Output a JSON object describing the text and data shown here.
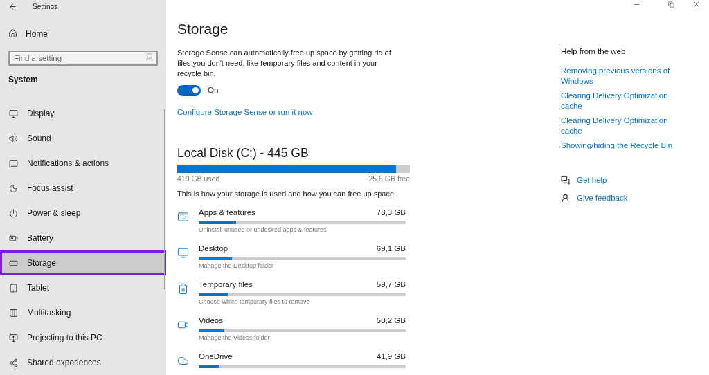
{
  "window": {
    "title": "Settings"
  },
  "sidebar": {
    "home": "Home",
    "search": {
      "placeholder": "Find a setting"
    },
    "section": "System",
    "items": [
      {
        "label": "Display",
        "selected": false
      },
      {
        "label": "Sound",
        "selected": false
      },
      {
        "label": "Notifications & actions",
        "selected": false
      },
      {
        "label": "Focus assist",
        "selected": false
      },
      {
        "label": "Power & sleep",
        "selected": false
      },
      {
        "label": "Battery",
        "selected": false
      },
      {
        "label": "Storage",
        "selected": true
      },
      {
        "label": "Tablet",
        "selected": false
      },
      {
        "label": "Multitasking",
        "selected": false
      },
      {
        "label": "Projecting to this PC",
        "selected": false
      },
      {
        "label": "Shared experiences",
        "selected": false
      }
    ]
  },
  "page": {
    "title": "Storage",
    "description": "Storage Sense can automatically free up space by getting rid of files you don't need, like temporary files and content in your recycle bin.",
    "toggle": {
      "on": true,
      "label": "On"
    },
    "configure_link": "Configure Storage Sense or run it now",
    "disk": {
      "title": "Local Disk (C:) - 445 GB",
      "level": 0.94,
      "used": "419 GB used",
      "free": "25,6 GB free"
    },
    "usage_intro": "This is how your storage is used and how you can free up space.",
    "categories": [
      {
        "name": "Apps & features",
        "size": "78,3 GB",
        "level": 0.18,
        "hint": "Uninstall unused or undesired apps & features"
      },
      {
        "name": "Desktop",
        "size": "69,1 GB",
        "level": 0.16,
        "hint": "Manage the Desktop folder"
      },
      {
        "name": "Temporary files",
        "size": "59,7 GB",
        "level": 0.14,
        "hint": "Choose which temporary files to remove"
      },
      {
        "name": "Videos",
        "size": "50,2 GB",
        "level": 0.12,
        "hint": "Manage the Videos folder"
      },
      {
        "name": "OneDrive",
        "size": "41,9 GB",
        "level": 0.1
      }
    ]
  },
  "help": {
    "title": "Help from the web",
    "links": [
      "Removing previous versions of Windows",
      "Clearing Delivery Optimization cache",
      "Clearing Delivery Optimization cache",
      "Showing/hiding the Recycle Bin"
    ],
    "actions": [
      "Get help",
      "Give feedback"
    ]
  }
}
